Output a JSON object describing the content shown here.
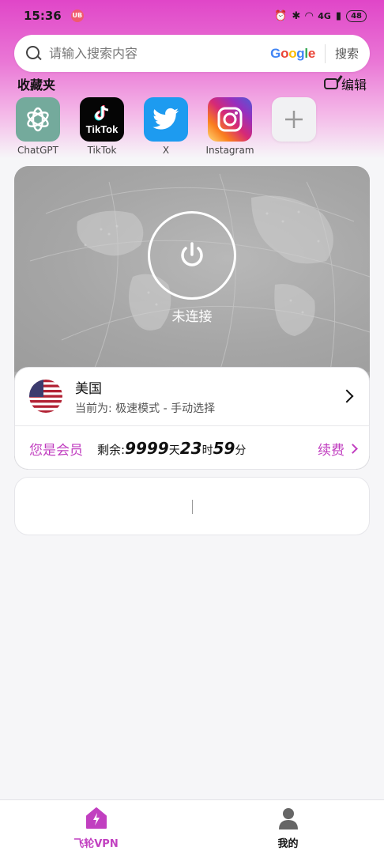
{
  "status_bar": {
    "time": "15:36",
    "app_badge": "UB",
    "network": "4G",
    "battery": "48"
  },
  "search": {
    "placeholder": "请输入搜索内容",
    "engine": "Google",
    "button_label": "搜索"
  },
  "favorites": {
    "title": "收藏夹",
    "edit_label": "编辑",
    "items": [
      {
        "label": "ChatGPT",
        "icon": "chatgpt-icon"
      },
      {
        "label": "TikTok",
        "icon": "tiktok-icon"
      },
      {
        "label": "X",
        "icon": "twitter-bird-icon"
      },
      {
        "label": "Instagram",
        "icon": "instagram-icon"
      },
      {
        "label": "",
        "icon": "plus-icon"
      }
    ],
    "tiktok_wordmark": "TikTok"
  },
  "vpn": {
    "status": "未连接",
    "server_country": "美国",
    "server_mode": "当前为: 极速模式 - 手动选择",
    "member_label": "您是会员",
    "remaining_label": "剩余:",
    "remaining_days": "9999",
    "unit_days": "天",
    "remaining_hours": "23",
    "unit_hours": "时",
    "remaining_minutes": "59",
    "unit_minutes": "分",
    "renew_label": "续费"
  },
  "bottom_nav": {
    "home_label": "飞轮VPN",
    "mine_label": "我的"
  },
  "colors": {
    "accent": "#c13fc0",
    "header_gradient_top": "#e046c8",
    "card_gray": "#a9a9a9"
  }
}
